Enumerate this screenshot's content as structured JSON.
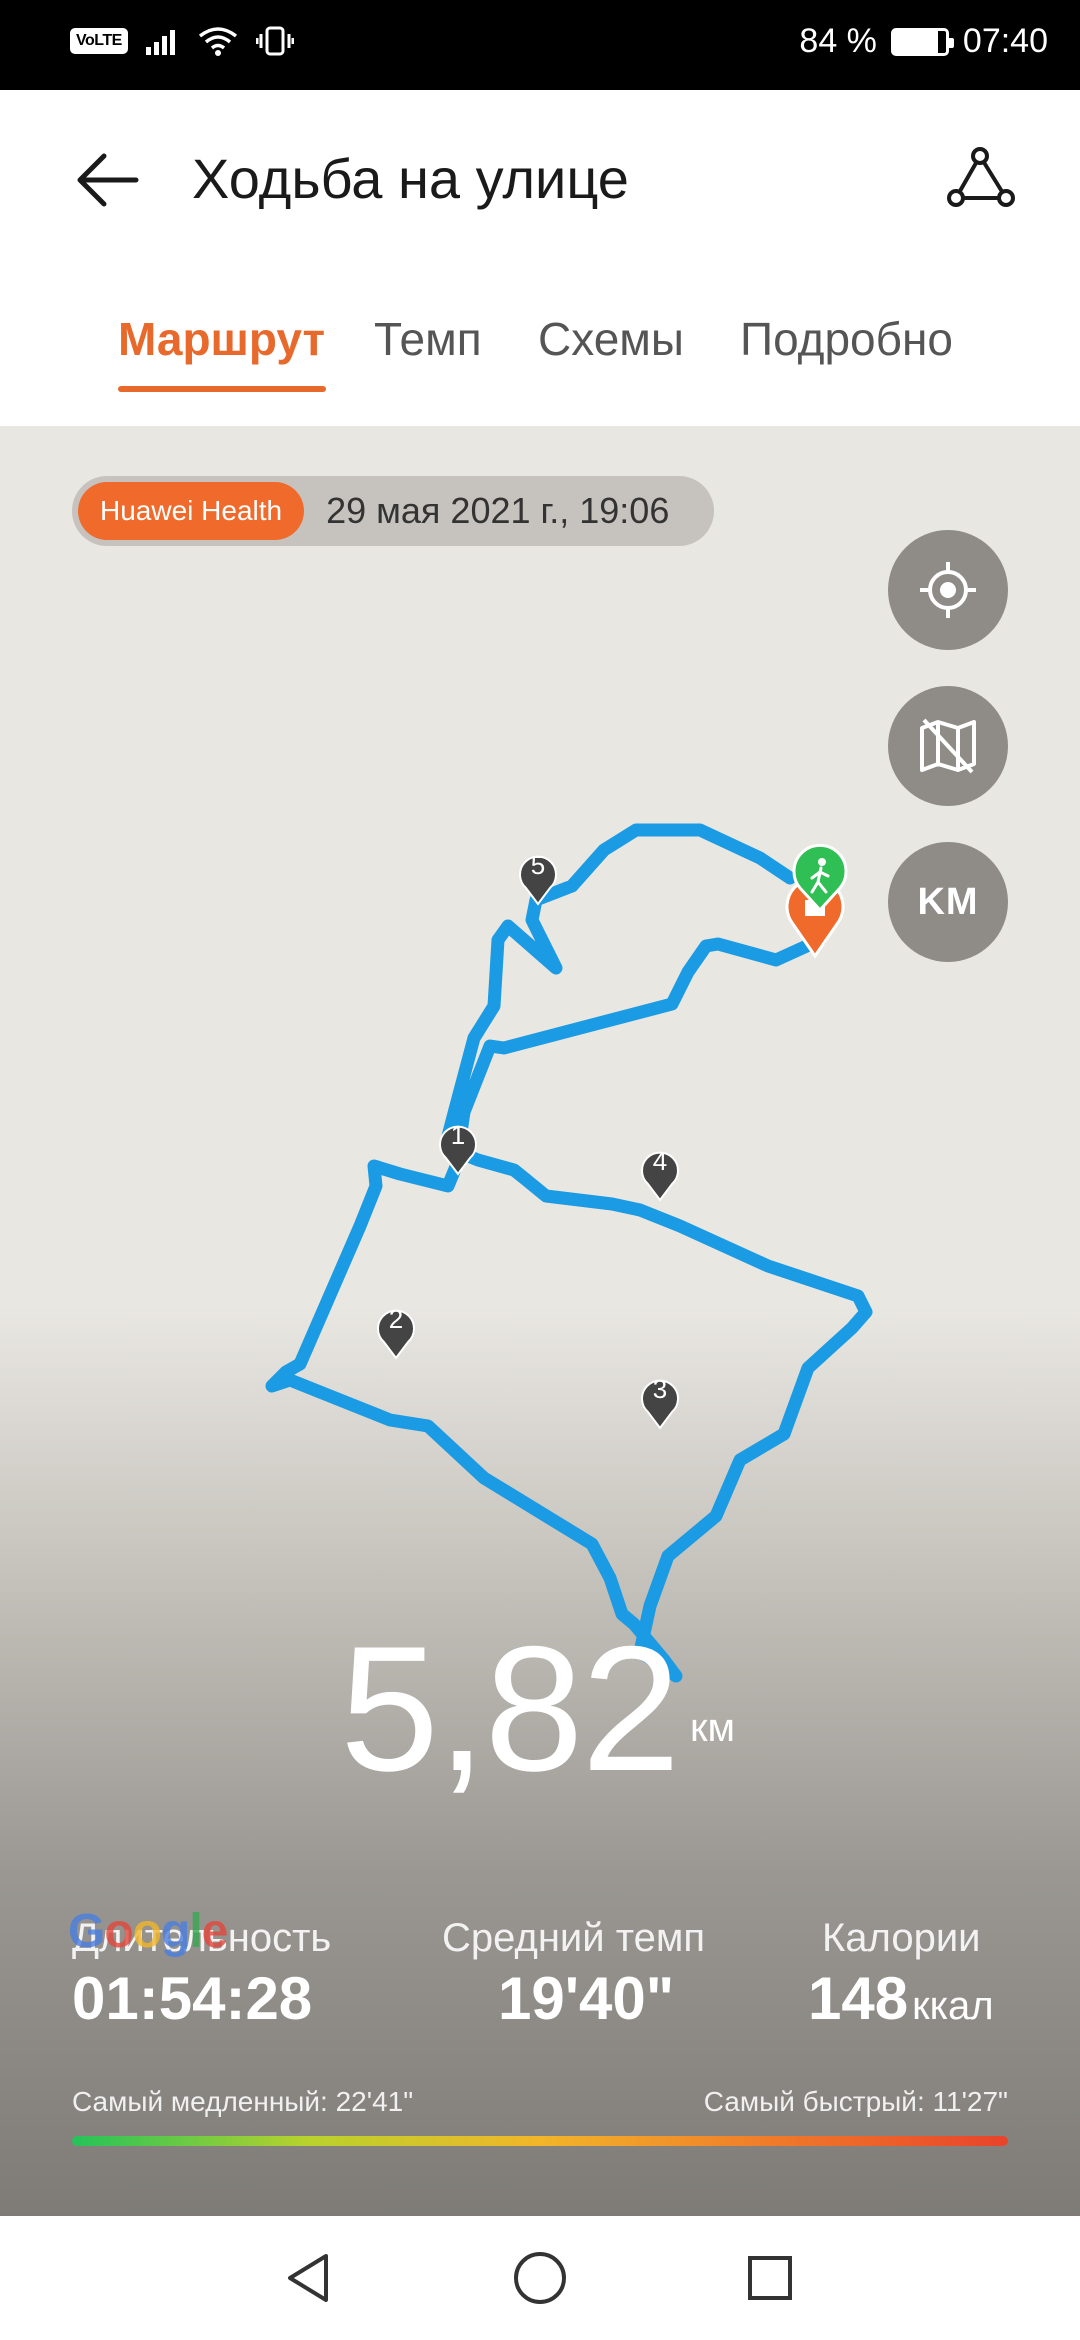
{
  "status_bar": {
    "volte": "VoLTE",
    "battery": "84 %",
    "battery_level": 0.84,
    "time": "07:40"
  },
  "header": {
    "title": "Ходьба на улице",
    "back_icon": "arrow-left-icon",
    "route_icon": "route-share-icon"
  },
  "tabs": [
    {
      "label": "Маршрут",
      "active": true
    },
    {
      "label": "Темп",
      "active": false
    },
    {
      "label": "Схемы",
      "active": false
    },
    {
      "label": "Подробно",
      "active": false
    }
  ],
  "map": {
    "source_badge": "Huawei Health",
    "date": "29 мая 2021 г., 19:06",
    "buttons": [
      {
        "icon": "locate-icon"
      },
      {
        "icon": "map-hide-icon"
      },
      {
        "label": "KM"
      }
    ],
    "route_color": "#1a9be3",
    "markers": [
      "1",
      "2",
      "3",
      "4",
      "5"
    ],
    "start_icon": "walker-icon",
    "watermark": "Google"
  },
  "summary": {
    "distance": "5,82",
    "distance_unit": "км",
    "stats": [
      {
        "label": "Длительность",
        "value": "01:54:28",
        "unit": ""
      },
      {
        "label": "Средний темп",
        "value": "19'40\"",
        "unit": ""
      },
      {
        "label": "Калории",
        "value": "148",
        "unit": "ккал"
      }
    ],
    "slowest": "Самый медленный: 22'41\"",
    "fastest": "Самый быстрый: 11'27\""
  },
  "nav_bar": {
    "back_icon": "nav-back-icon",
    "home_icon": "nav-home-icon",
    "recents_icon": "nav-recents-icon"
  }
}
